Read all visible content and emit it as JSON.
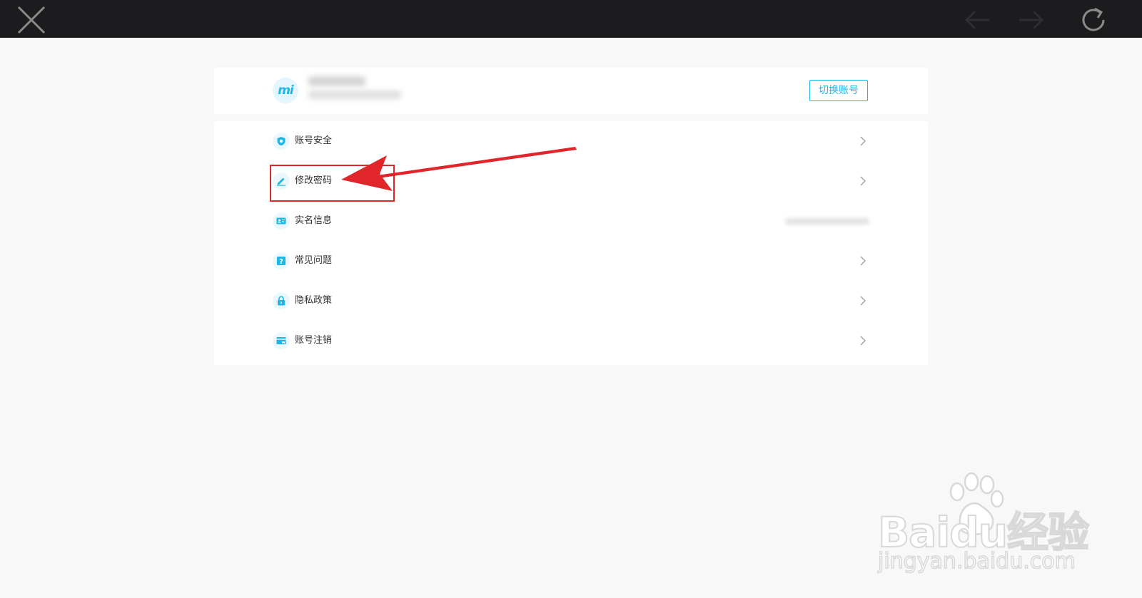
{
  "toolbar": {
    "close_icon": "close-icon",
    "back_icon": "back-arrow-icon",
    "forward_icon": "forward-arrow-icon",
    "reload_icon": "reload-icon"
  },
  "account": {
    "avatar_text": "mi",
    "switch_label": "切换账号"
  },
  "menu": {
    "items": [
      {
        "label": "账号安全",
        "icon": "shield-icon"
      },
      {
        "label": "修改密码",
        "icon": "edit-pencil-icon"
      },
      {
        "label": "实名信息",
        "icon": "id-card-icon"
      },
      {
        "label": "常见问题",
        "icon": "question-icon"
      },
      {
        "label": "隐私政策",
        "icon": "lock-icon"
      },
      {
        "label": "账号注销",
        "icon": "account-cancel-icon"
      }
    ]
  },
  "watermark": {
    "brand": "Baidu经验",
    "url": "jingyan.baidu.com"
  },
  "colors": {
    "accent": "#1fb5e6",
    "highlight": "#e0262b",
    "topbar": "#1c1c1e",
    "background": "#f8f8f8"
  }
}
